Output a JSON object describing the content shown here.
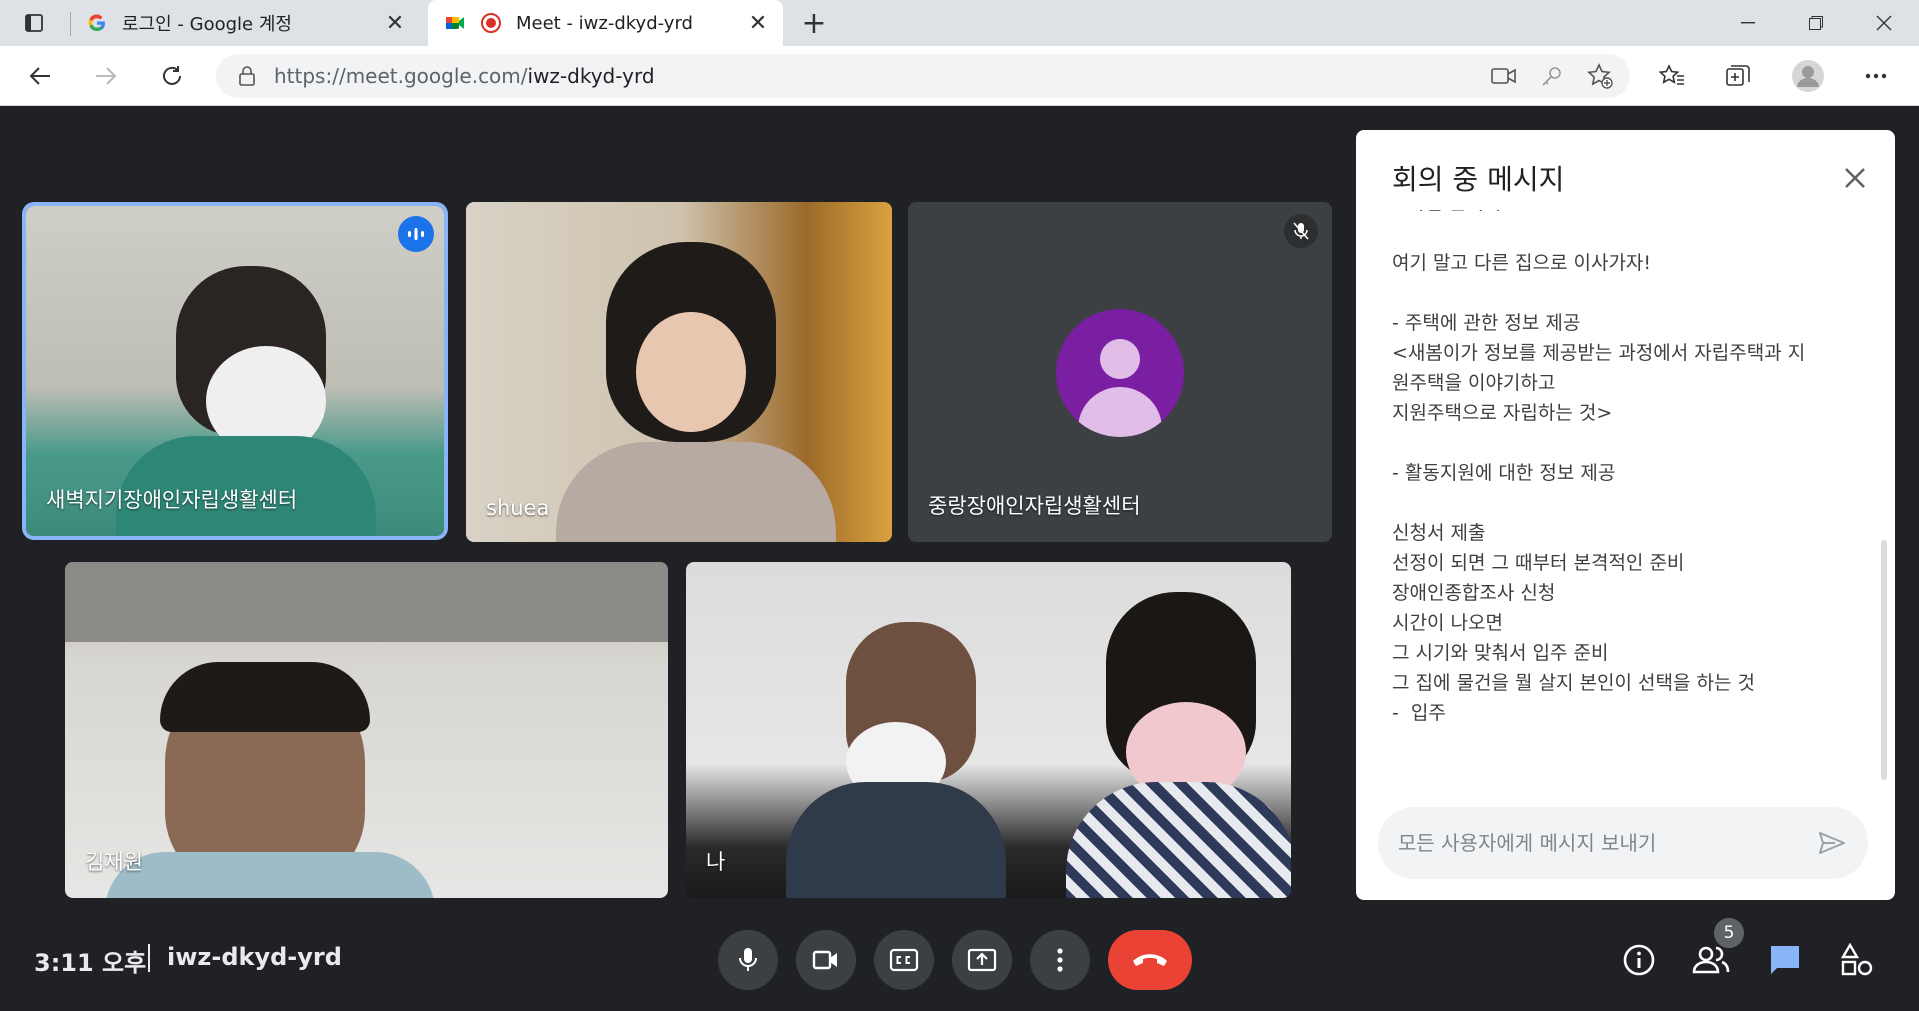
{
  "browser": {
    "tabs": [
      {
        "title": "로그인 - Google 계정",
        "close": "✕"
      },
      {
        "title": "Meet - iwz-dkyd-yrd",
        "close": "✕"
      }
    ],
    "new_tab": "+",
    "url_host": "https://meet.google.com/",
    "url_path": "iwz-dkyd-yrd"
  },
  "participants": [
    {
      "name": "새벽지기장애인자립생활센터",
      "speaking": true
    },
    {
      "name": "shuea"
    },
    {
      "name": "중랑장애인자립생활센터",
      "muted": true
    },
    {
      "name": "김재원"
    },
    {
      "name": "나"
    }
  ],
  "chat": {
    "title": "회의 중 메시지",
    "clipped_first_line": "<자립 준비기>",
    "lines": [
      "",
      "여기 말고 다른 집으로 이사가자!",
      "",
      "- 주택에 관한 정보 제공",
      "<새봄이가 정보를 제공받는 과정에서 자립주택과 지",
      "원주택을 이야기하고",
      "지원주택으로 자립하는 것>",
      "",
      "- 활동지원에 대한 정보 제공",
      "",
      "신청서 제출",
      "선정이 되면 그 때부터 본격적인 준비",
      "장애인종합조사 신청",
      "시간이 나오면",
      "그 시기와 맞춰서 입주 준비",
      "그 집에 물건을 뭘 살지 본인이 선택을 하는 것",
      "-  입주"
    ],
    "input_placeholder": "모든 사용자에게 메시지 보내기"
  },
  "footer": {
    "time": "3:11 오후",
    "meeting_code": "iwz-dkyd-yrd",
    "participant_count": "5"
  },
  "colors": {
    "stage_bg": "#202124",
    "hangup": "#ea4335",
    "speaking_outline": "#8ab4f8",
    "chat_icon": "#8ab4f8",
    "avatar": "#7b1fa2"
  }
}
